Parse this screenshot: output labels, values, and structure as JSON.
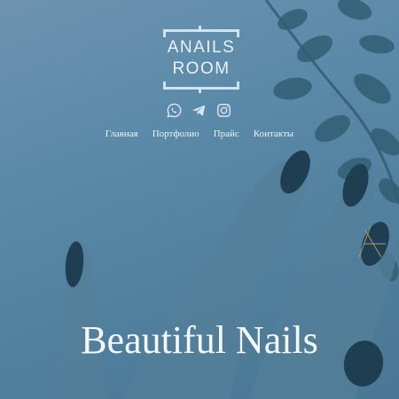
{
  "brand": {
    "line1": "ANAILS",
    "line2": "ROOM",
    "frame_color": "#cfe3f1"
  },
  "social": [
    {
      "name": "whatsapp-icon"
    },
    {
      "name": "telegram-icon"
    },
    {
      "name": "instagram-icon"
    }
  ],
  "nav": {
    "items": [
      "Главная",
      "Портфолио",
      "Прайс",
      "Контакты"
    ]
  },
  "hero": {
    "headline": "Beautiful Nails",
    "overlay_color": "#5a8aa8"
  }
}
